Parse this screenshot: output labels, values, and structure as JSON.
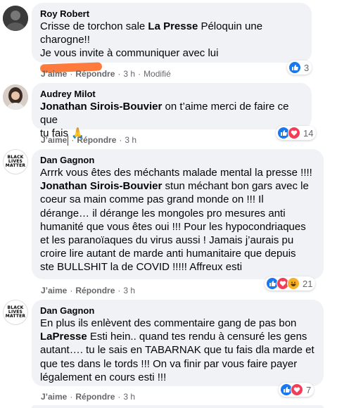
{
  "comments": [
    {
      "author": "Roy Robert",
      "lines": [
        "Crisse de torchon sale ",
        "La Presse",
        " Péloquin une charogne!!",
        "Je vous invite à communiquer avec lui"
      ],
      "like": "J’aime",
      "reply": "Répondre",
      "time": "3 h",
      "edited": "Modifié",
      "reaction_count": "3",
      "reactions": [
        "like-icon"
      ]
    },
    {
      "author": "Audrey Milot",
      "mention": "Jonathan Sirois-Bouvier",
      "text_after": " on t’aime merci de faire ce que",
      "text_line2": "tu fais ",
      "emoji": "🙏",
      "like": "J’aime",
      "reply": "Répondre",
      "time": "3 h",
      "reaction_count": "14",
      "reactions": [
        "like-icon",
        "love-icon"
      ]
    },
    {
      "author": "Dan Gagnon",
      "line1": "Arrrk vous êtes des méchants malade mental la presse !!!!",
      "mention": "Jonathan Sirois-Bouvier",
      "line2_after": " stun méchant bon gars avec le",
      "line3": "coeur sa main comme pas grand monde on !!! Il",
      "line4": "dérange… il dérange les mongoles pro mesures anti",
      "line5": "humanité que vous êtes oui !!! Pour les hypocondriaques",
      "line6": "et les paranoïaques du virus aussi ! Jamais j’aurais pu",
      "line7": "croire lire autant de marde anti humanitaire que depuis",
      "line8": "ste BULLSHIT la de COVID !!!!! Affreux esti",
      "like": "J’aime",
      "reply": "Répondre",
      "time": "3 h",
      "reaction_count": "21",
      "reactions": [
        "like-icon",
        "love-icon",
        "laugh-icon"
      ]
    },
    {
      "author": "Dan Gagnon",
      "line1": "En plus ils enlèvent des commentaire gang de pas bon",
      "mention": "LaPresse",
      "line2_after": " Esti hein.. quand tes rendu à censuré les gens",
      "line3": "autant…. tu le sais en TABARNAK que tu fais dla marde et",
      "line4": "que tes dans le tords !!! On va finir par vous faire payer",
      "line5": "légalement en cours esti !!!",
      "like": "J’aime",
      "reply": "Répondre",
      "time": "3 h",
      "reaction_count": "7",
      "reactions": [
        "like-icon",
        "love-icon"
      ]
    }
  ],
  "avatar_badge": [
    "BLACK",
    "LIVES",
    "MATTER"
  ],
  "colors": {
    "like": "#1877f2",
    "love": "#f33e58",
    "laugh": "#f7b125",
    "bubble": "#f0f2f5",
    "meta": "#65676b"
  }
}
